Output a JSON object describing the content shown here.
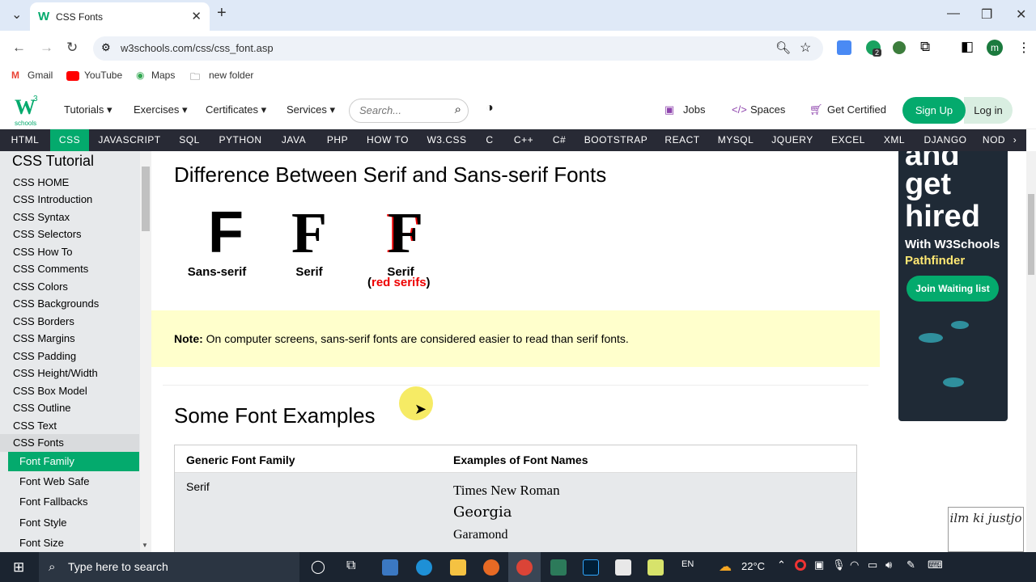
{
  "browser": {
    "tab_title": "CSS Fonts",
    "url": "w3schools.com/css/css_font.asp",
    "bookmarks": [
      "Gmail",
      "YouTube",
      "Maps",
      "new folder"
    ],
    "ext_badge": "2",
    "profile": "m"
  },
  "header": {
    "menus": [
      "Tutorials",
      "Exercises",
      "Certificates",
      "Services"
    ],
    "search_placeholder": "Search...",
    "links": [
      "Jobs",
      "Spaces",
      "Get Certified"
    ],
    "signup": "Sign Up",
    "login": "Log in"
  },
  "topnav": [
    "HTML",
    "CSS",
    "JAVASCRIPT",
    "SQL",
    "PYTHON",
    "JAVA",
    "PHP",
    "HOW TO",
    "W3.CSS",
    "C",
    "C++",
    "C#",
    "BOOTSTRAP",
    "REACT",
    "MYSQL",
    "JQUERY",
    "EXCEL",
    "XML",
    "DJANGO",
    "NOD"
  ],
  "sidebar": {
    "title": "CSS Tutorial",
    "items": [
      "CSS HOME",
      "CSS Introduction",
      "CSS Syntax",
      "CSS Selectors",
      "CSS How To",
      "CSS Comments",
      "CSS Colors",
      "CSS Backgrounds",
      "CSS Borders",
      "CSS Margins",
      "CSS Padding",
      "CSS Height/Width",
      "CSS Box Model",
      "CSS Outline",
      "CSS Text",
      "CSS Fonts"
    ],
    "sub": [
      "Font Family",
      "Font Web Safe",
      "Font Fallbacks",
      "Font Style",
      "Font Size"
    ]
  },
  "main": {
    "h1": "Difference Between Serif and Sans-serif Fonts",
    "letter": "F",
    "caps": [
      "Sans-serif",
      "Serif",
      "Serif"
    ],
    "red_caption": "red serifs",
    "note_label": "Note:",
    "note_text": " On computer screens, sans-serif fonts are considered easier to read than serif fonts.",
    "h2": "Some Font Examples",
    "table": {
      "headers": [
        "Generic Font Family",
        "Examples of Font Names"
      ],
      "family": "Serif",
      "examples": [
        "Times New Roman",
        "Georgia",
        "Garamond"
      ]
    }
  },
  "ad": {
    "lines": [
      "and",
      "get",
      "hired"
    ],
    "sub1": "With W3Schools",
    "sub2": "Pathfinder",
    "button": "Join Waiting list"
  },
  "watermark": "ilm ki justjo",
  "taskbar": {
    "search": "Type here to search",
    "lang": "EN",
    "temp": "22°C"
  },
  "colors": {
    "accent": "#04aa6d",
    "nav": "#282a35",
    "note": "#ffffcc"
  }
}
